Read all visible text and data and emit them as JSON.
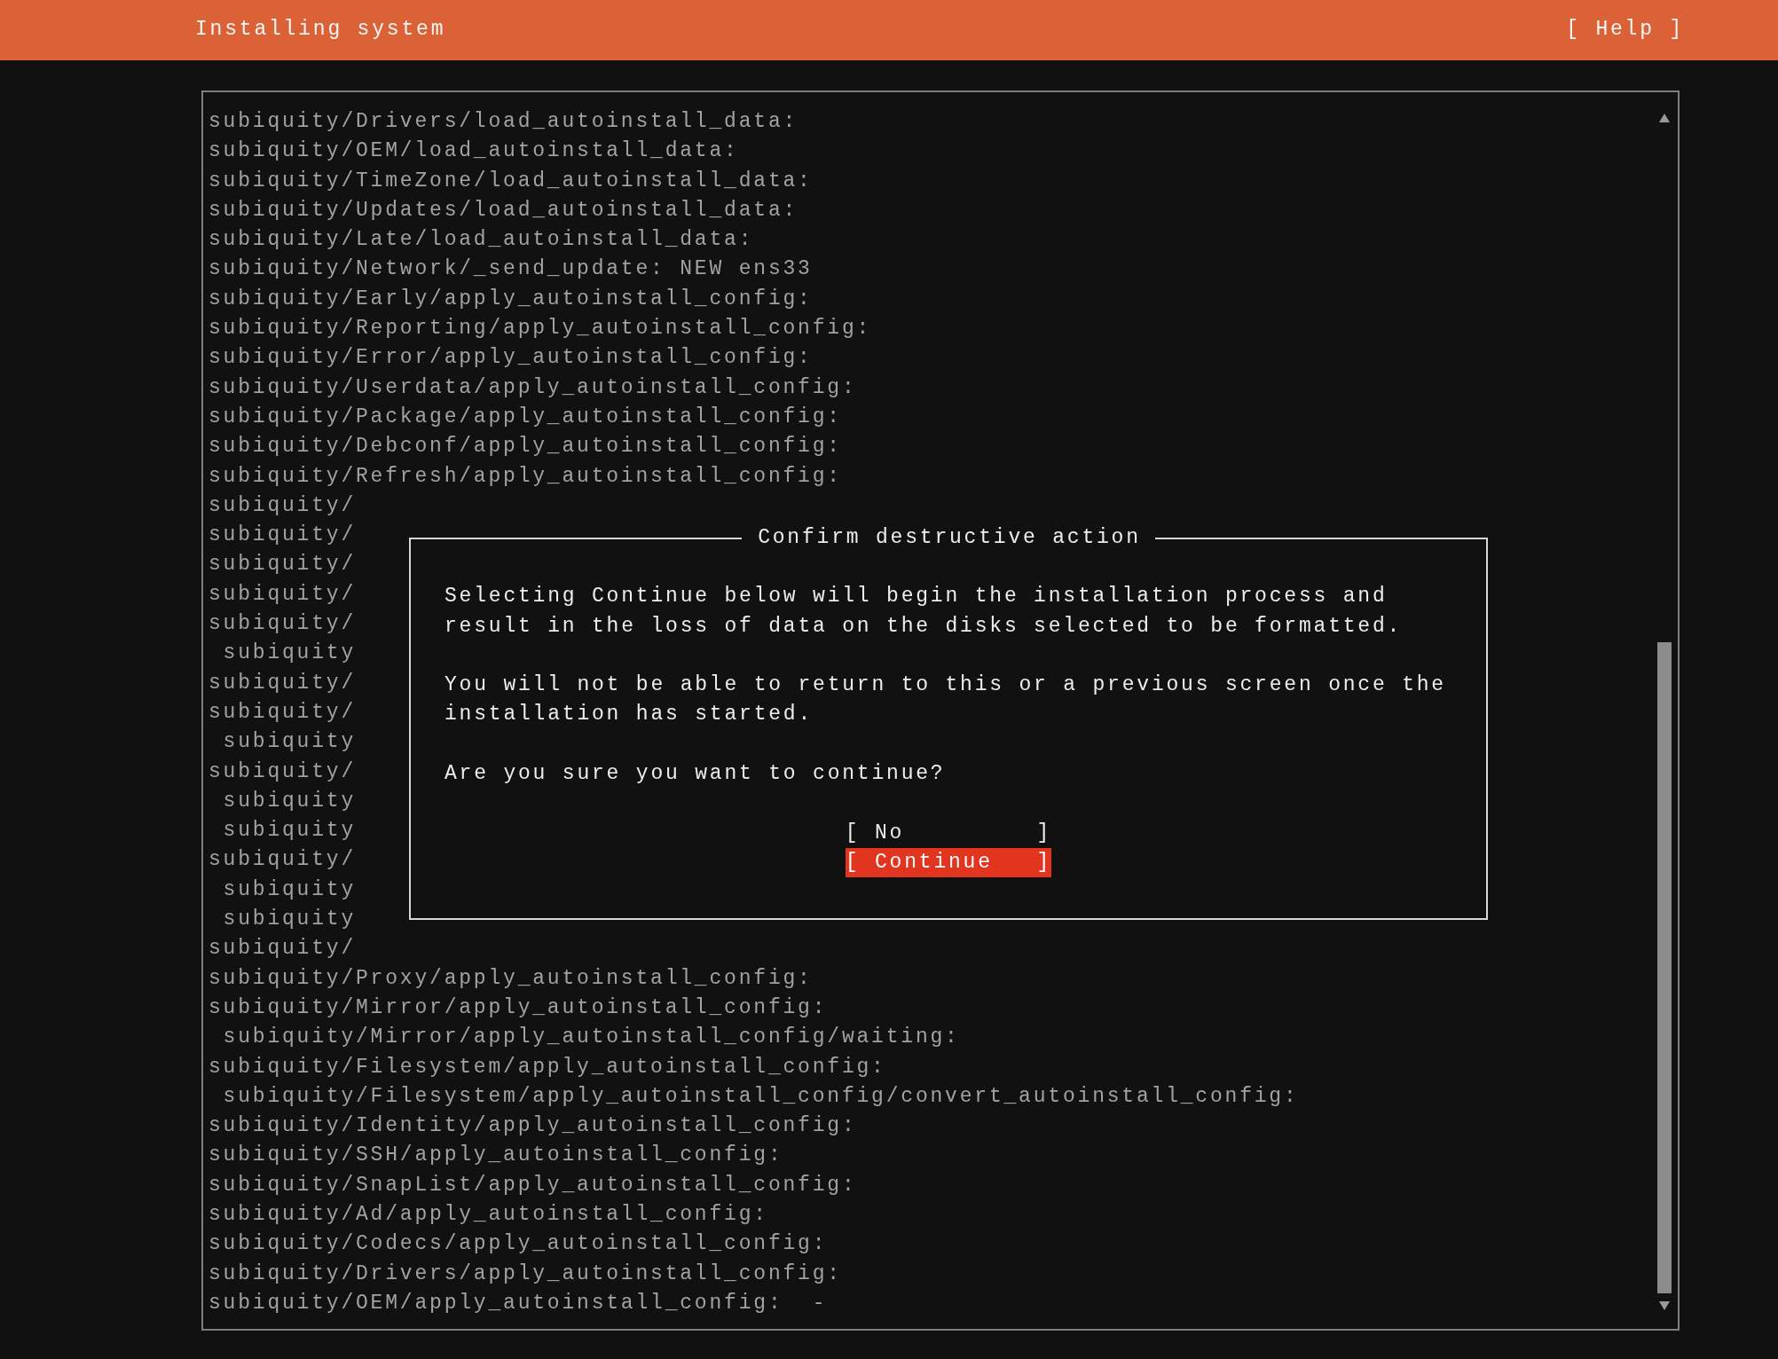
{
  "header": {
    "title": "Installing system",
    "help_button": "[ Help ]"
  },
  "log": {
    "lines": [
      {
        "text": "subiquity/Drivers/load_autoinstall_data:"
      },
      {
        "text": "subiquity/OEM/load_autoinstall_data:"
      },
      {
        "text": "subiquity/TimeZone/load_autoinstall_data:"
      },
      {
        "text": "subiquity/Updates/load_autoinstall_data:"
      },
      {
        "text": "subiquity/Late/load_autoinstall_data:"
      },
      {
        "text": "subiquity/Network/_send_update: NEW ens33"
      },
      {
        "text": "subiquity/Early/apply_autoinstall_config:"
      },
      {
        "text": "subiquity/Reporting/apply_autoinstall_config:"
      },
      {
        "text": "subiquity/Error/apply_autoinstall_config:"
      },
      {
        "text": "subiquity/Userdata/apply_autoinstall_config:"
      },
      {
        "text": "subiquity/Package/apply_autoinstall_config:"
      },
      {
        "text": "subiquity/Debconf/apply_autoinstall_config:"
      },
      {
        "text": "subiquity/Refresh/apply_autoinstall_config:"
      },
      {
        "text": "subiquity/"
      },
      {
        "text": "subiquity/"
      },
      {
        "text": "subiquity/"
      },
      {
        "text": "subiquity/"
      },
      {
        "text": "subiquity/",
        "children": [
          {
            "text": "subiquity"
          }
        ]
      },
      {
        "text": "subiquity/"
      },
      {
        "text": "subiquity/",
        "children": [
          {
            "text": "subiquity"
          }
        ]
      },
      {
        "text": "subiquity/",
        "children": [
          {
            "text": "subiquity"
          },
          {
            "text": "subiquity"
          }
        ]
      },
      {
        "text": "subiquity/",
        "children": [
          {
            "text": "subiquity"
          },
          {
            "text": "subiquity"
          }
        ]
      },
      {
        "text": "subiquity/"
      },
      {
        "text": "subiquity/Proxy/apply_autoinstall_config:"
      },
      {
        "text": "subiquity/Mirror/apply_autoinstall_config:",
        "children": [
          {
            "text": "subiquity/Mirror/apply_autoinstall_config/waiting:"
          }
        ]
      },
      {
        "text": "subiquity/Filesystem/apply_autoinstall_config:",
        "children": [
          {
            "text": "subiquity/Filesystem/apply_autoinstall_config/convert_autoinstall_config:"
          }
        ]
      },
      {
        "text": "subiquity/Identity/apply_autoinstall_config:"
      },
      {
        "text": "subiquity/SSH/apply_autoinstall_config:"
      },
      {
        "text": "subiquity/SnapList/apply_autoinstall_config:"
      },
      {
        "text": "subiquity/Ad/apply_autoinstall_config:"
      },
      {
        "text": "subiquity/Codecs/apply_autoinstall_config:"
      },
      {
        "text": "subiquity/Drivers/apply_autoinstall_config:"
      },
      {
        "text": "subiquity/OEM/apply_autoinstall_config:",
        "spinner": "-"
      }
    ]
  },
  "dialog": {
    "title": "Confirm destructive action",
    "paragraphs": [
      "Selecting Continue below will begin the installation process and result in the loss of data on the disks selected to be formatted.",
      "You will not be able to return to this or a previous screen once the installation has started.",
      "Are you sure you want to continue?"
    ],
    "buttons": [
      {
        "label": "[ No         ]",
        "selected": false
      },
      {
        "label": "[ Continue   ]",
        "selected": true
      }
    ]
  }
}
